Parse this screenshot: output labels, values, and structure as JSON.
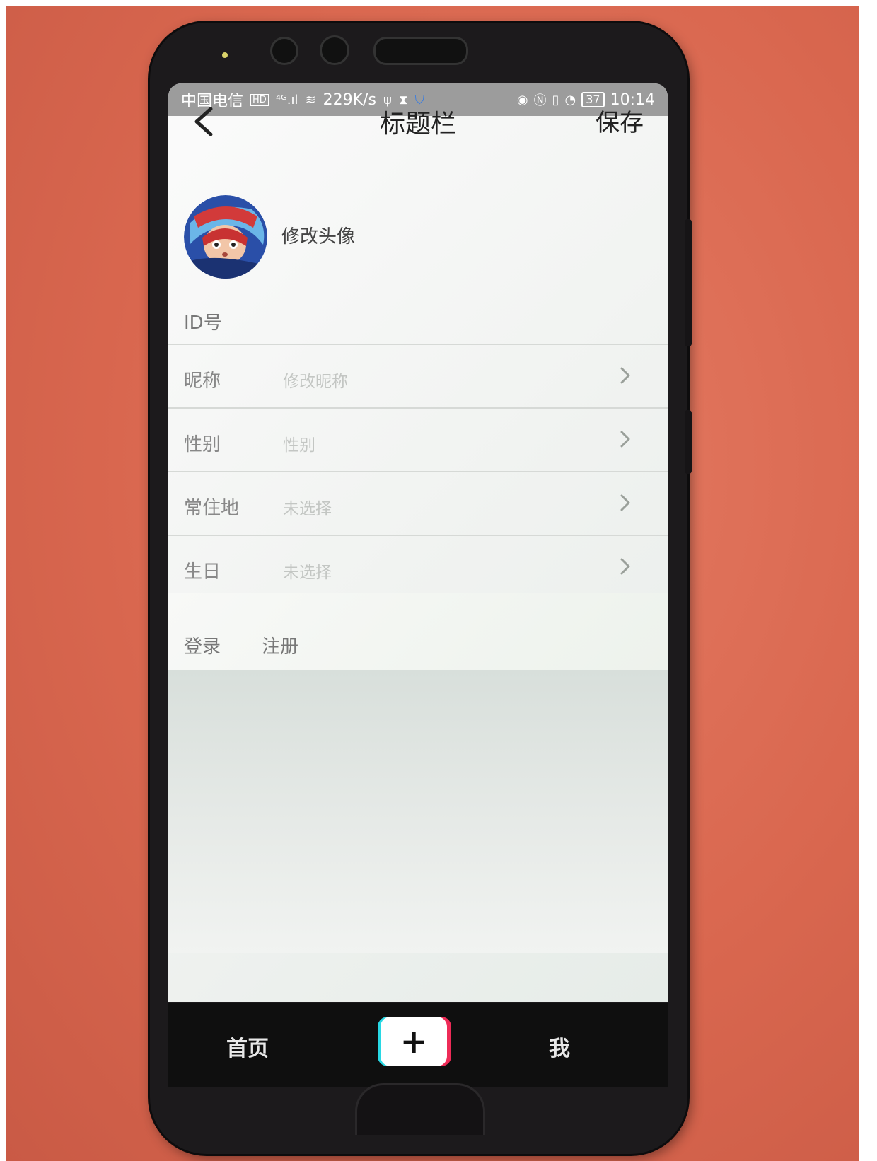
{
  "status_bar": {
    "carrier": "中国电信",
    "net_badge": "HD",
    "signal": "⁴ᴳ.ıl",
    "wifi": "≋",
    "speed": "229K/s",
    "icons_left": [
      "usb-icon",
      "hourglass-icon",
      "shield-icon"
    ],
    "icons_right": [
      "eye-icon",
      "nfc-icon",
      "vibrate-icon",
      "speed-icon"
    ],
    "battery": "37",
    "time": "10:14"
  },
  "title_bar": {
    "title": "标题栏",
    "save_label": "保存"
  },
  "avatar": {
    "label": "修改头像"
  },
  "id_row": {
    "label": "ID号"
  },
  "form": {
    "rows": [
      {
        "label": "昵称",
        "value": "修改昵称"
      },
      {
        "label": "性别",
        "value": "性别"
      },
      {
        "label": "常住地",
        "value": "未选择"
      },
      {
        "label": "生日",
        "value": "未选择"
      }
    ]
  },
  "auth": {
    "login_label": "登录",
    "register_label": "注册"
  },
  "tab_bar": {
    "home_label": "首页",
    "add_label": "+",
    "me_label": "我"
  },
  "colors": {
    "backdrop": "#d9674f",
    "phone_frame": "#1c1a1c",
    "status_bar": "#9c9c9c",
    "tab_bar": "#0f0f0f",
    "plus_cyan": "#28d8e4",
    "plus_red": "#ee2b57"
  }
}
